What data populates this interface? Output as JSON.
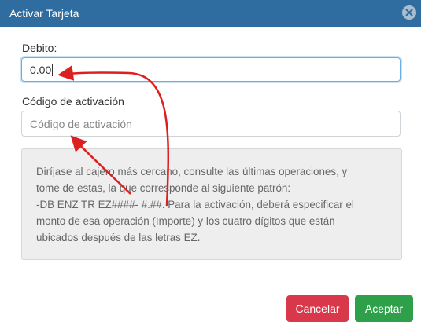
{
  "dialog": {
    "title": "Activar Tarjeta"
  },
  "form": {
    "debito_label": "Debito:",
    "debito_value": "0.00",
    "codigo_label": "Código de activación",
    "codigo_placeholder": "Código de activación"
  },
  "info": {
    "lines": [
      "Diríjase al cajero más cercano, consulte las últimas operaciones, y",
      "tome de estas, la que corresponde al siguiente patrón:",
      "-DB ENZ TR EZ####- #.##. Para la activación, deberá especificar el",
      "monto de esa operación (Importe) y los cuatro dígitos que están",
      "ubicados después de las letras EZ."
    ]
  },
  "buttons": {
    "cancel": "Cancelar",
    "accept": "Aceptar"
  },
  "colors": {
    "header": "#2f6da0",
    "cancel": "#d9374a",
    "accept": "#2fa04a",
    "annotation_arrow": "#dd1f1f"
  }
}
